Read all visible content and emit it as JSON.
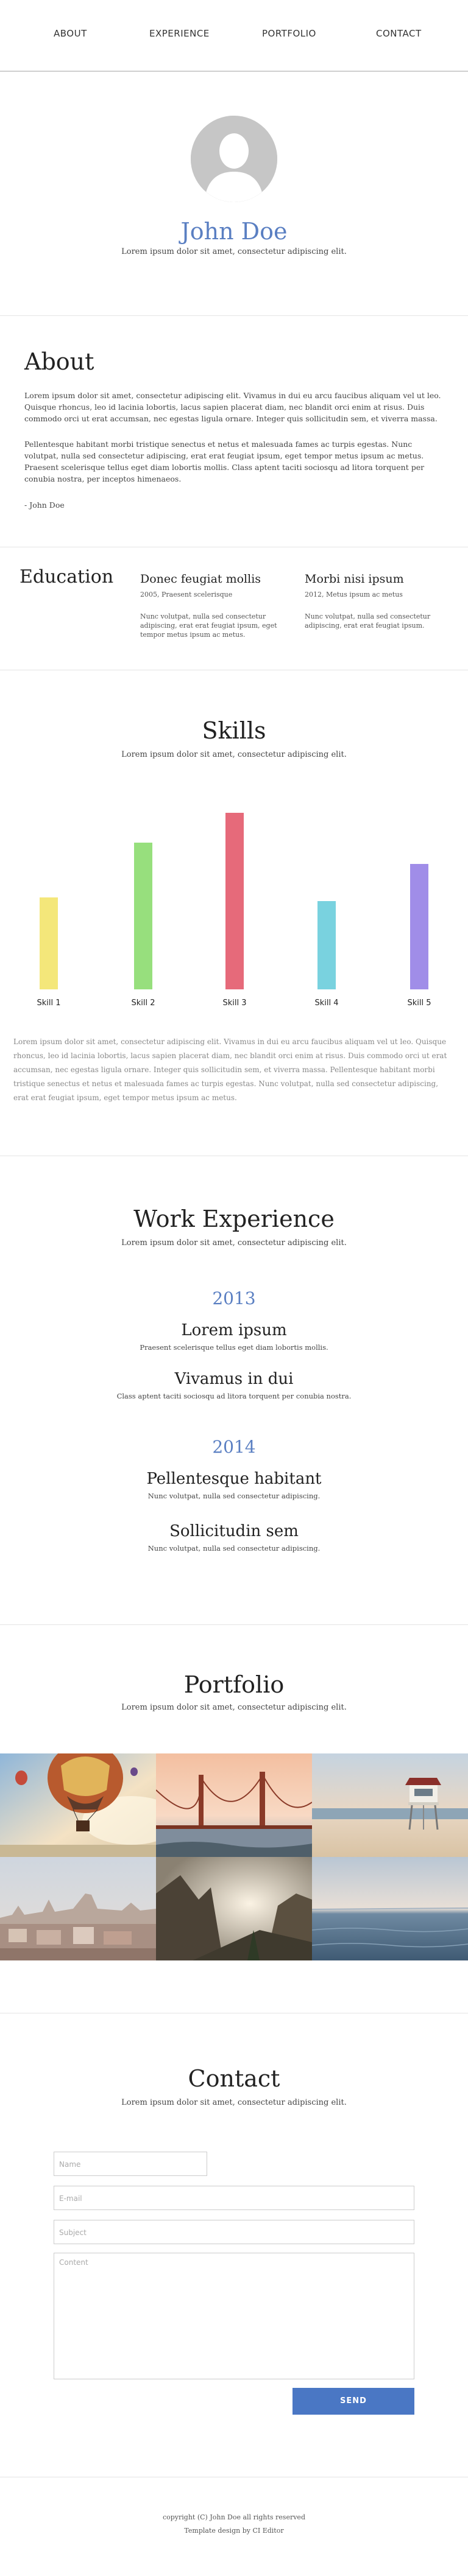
{
  "nav": {
    "items": [
      "ABOUT",
      "EXPERIENCE",
      "PORTFOLIO",
      "CONTACT"
    ]
  },
  "hero": {
    "name": "John Doe",
    "tagline": "Lorem ipsum dolor sit amet, consectetur adipiscing elit."
  },
  "about": {
    "title": "About",
    "p1": "Lorem ipsum dolor sit amet, consectetur adipiscing elit. Vivamus in dui eu arcu faucibus aliquam vel ut leo. Quisque rhoncus, leo id lacinia lobortis, lacus sapien placerat diam, nec blandit orci enim at risus. Duis commodo orci ut erat accumsan, nec egestas ligula ornare. Integer quis sollicitudin sem, et viverra massa.",
    "p2": "Pellentesque habitant morbi tristique senectus et netus et malesuada fames ac turpis egestas. Nunc volutpat, nulla sed consectetur adipiscing, erat erat feugiat ipsum, eget tempor metus ipsum ac metus. Praesent scelerisque tellus eget diam lobortis mollis. Class aptent taciti sociosqu ad litora torquent per conubia nostra, per inceptos himenaeos.",
    "signature": "- John Doe"
  },
  "education": {
    "title": "Education",
    "items": [
      {
        "heading": "Donec feugiat mollis",
        "sub": "2005, Praesent scelerisque",
        "desc": "Nunc volutpat, nulla sed consectetur adipiscing, erat erat feugiat ipsum, eget tempor metus ipsum ac metus."
      },
      {
        "heading": "Morbi nisi ipsum",
        "sub": "2012, Metus ipsum ac metus",
        "desc": "Nunc volutpat, nulla sed consectetur adipiscing, erat erat feugiat ipsum."
      }
    ]
  },
  "skills": {
    "title": "Skills",
    "subtitle": "Lorem ipsum dolor sit amet, consectetur adipiscing elit.",
    "paragraph": "Lorem ipsum dolor sit amet, consectetur adipiscing elit. Vivamus in dui eu arcu faucibus aliquam vel ut leo. Quisque rhoncus, leo id lacinia lobortis, lacus sapien placerat diam, nec blandit orci enim at risus. Duis commodo orci ut erat accumsan, nec egestas ligula ornare. Integer quis sollicitudin sem, et viverra massa. Pellentesque habitant morbi tristique senectus et netus et malesuada fames ac turpis egestas. Nunc volutpat, nulla sed consectetur adipiscing, erat erat feugiat ipsum, eget tempor metus ipsum ac metus."
  },
  "chart_data": {
    "type": "bar",
    "categories": [
      "Skill 1",
      "Skill 2",
      "Skill 3",
      "Skill 4",
      "Skill 5"
    ],
    "values": [
      52,
      83,
      100,
      50,
      71
    ],
    "colors": [
      "#f4e77a",
      "#97df7d",
      "#e66a7a",
      "#79d2df",
      "#a08de8"
    ],
    "ylim": [
      0,
      100
    ]
  },
  "work": {
    "title": "Work Experience",
    "subtitle": "Lorem ipsum dolor sit amet, consectetur adipiscing elit.",
    "years": [
      {
        "year": "2013",
        "jobs": [
          {
            "title": "Lorem ipsum",
            "desc": "Praesent scelerisque tellus eget diam lobortis mollis."
          },
          {
            "title": "Vivamus in dui",
            "desc": "Class aptent taciti sociosqu ad litora torquent per conubia nostra."
          }
        ]
      },
      {
        "year": "2014",
        "jobs": [
          {
            "title": "Pellentesque habitant",
            "desc": "Nunc volutpat, nulla sed consectetur adipiscing."
          },
          {
            "title": "Sollicitudin sem",
            "desc": "Nunc volutpat, nulla sed consectetur adipiscing."
          }
        ]
      }
    ]
  },
  "portfolio": {
    "title": "Portfolio",
    "subtitle": "Lorem ipsum dolor sit amet, consectetur adipiscing elit."
  },
  "contact": {
    "title": "Contact",
    "subtitle": "Lorem ipsum dolor sit amet, consectetur adipiscing elit.",
    "name_placeholder": "Name",
    "email_placeholder": "E-mail",
    "subject_placeholder": "Subject",
    "content_placeholder": "Content",
    "send_label": "SEND"
  },
  "footer": {
    "line1": "copyright (C) John Doe all rights reserved",
    "line2": "Template design by CI Editor"
  },
  "colors": {
    "accent": "#5a7fc2",
    "button": "#4a77c4"
  }
}
